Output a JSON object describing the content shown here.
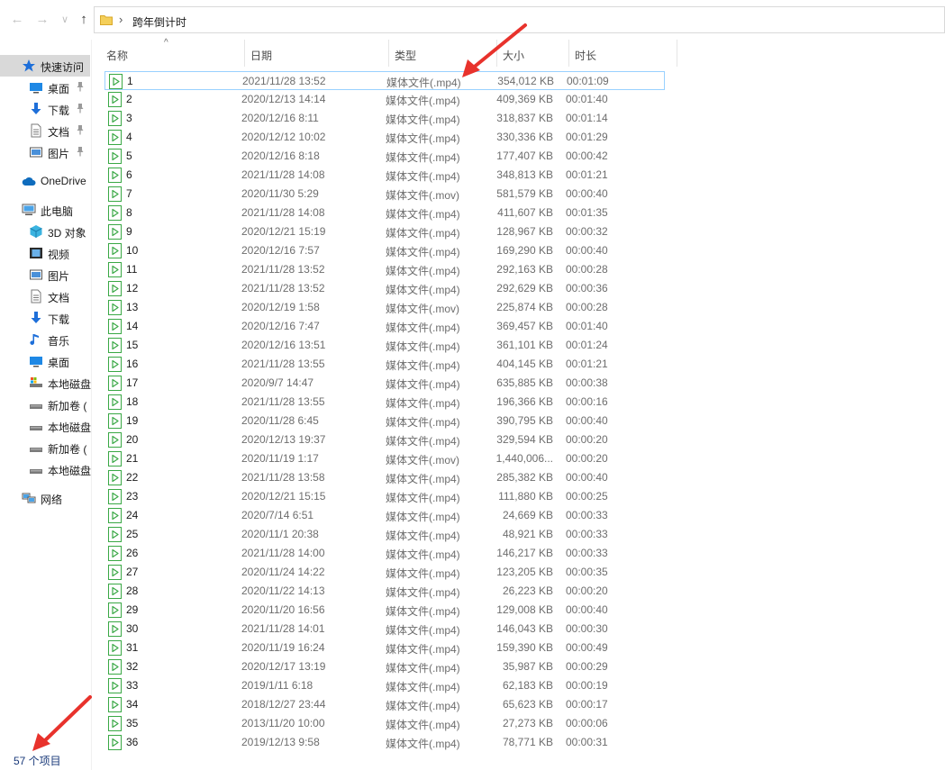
{
  "address": {
    "path": "跨年倒计时"
  },
  "nav_buttons": {
    "back": "←",
    "forward": "→",
    "recent": "∨",
    "up": "↑"
  },
  "sidebar": {
    "items": [
      {
        "label": "快速访问",
        "icon": "star-icon",
        "level": 0,
        "pinned": false,
        "selected": true
      },
      {
        "label": "桌面",
        "icon": "desktop-icon",
        "level": 1,
        "pinned": true
      },
      {
        "label": "下载",
        "icon": "download-icon",
        "level": 1,
        "pinned": true
      },
      {
        "label": "文档",
        "icon": "document-icon",
        "level": 1,
        "pinned": true
      },
      {
        "label": "图片",
        "icon": "pictures-icon",
        "level": 1,
        "pinned": true
      },
      {
        "label": "OneDrive",
        "icon": "cloud-icon",
        "level": 0,
        "gap": true
      },
      {
        "label": "此电脑",
        "icon": "computer-icon",
        "level": 0,
        "gap": true
      },
      {
        "label": "3D 对象",
        "icon": "cube-icon",
        "level": 1
      },
      {
        "label": "视频",
        "icon": "video-icon",
        "level": 1
      },
      {
        "label": "图片",
        "icon": "pictures-icon",
        "level": 1
      },
      {
        "label": "文档",
        "icon": "document-icon",
        "level": 1
      },
      {
        "label": "下载",
        "icon": "download-icon",
        "level": 1
      },
      {
        "label": "音乐",
        "icon": "music-icon",
        "level": 1
      },
      {
        "label": "桌面",
        "icon": "desktop-icon",
        "level": 1
      },
      {
        "label": "本地磁盘",
        "icon": "system-drive-icon",
        "level": 1
      },
      {
        "label": "新加卷 (",
        "icon": "drive-icon",
        "level": 1
      },
      {
        "label": "本地磁盘",
        "icon": "drive-icon",
        "level": 1
      },
      {
        "label": "新加卷 (",
        "icon": "drive-icon",
        "level": 1
      },
      {
        "label": "本地磁盘",
        "icon": "drive-icon",
        "level": 1
      },
      {
        "label": "网络",
        "icon": "network-icon",
        "level": 0,
        "gap": true
      }
    ]
  },
  "status": {
    "item_count": "57 个项目"
  },
  "columns": [
    {
      "label": "名称",
      "width": 160
    },
    {
      "label": "日期",
      "width": 160
    },
    {
      "label": "类型",
      "width": 120
    },
    {
      "label": "大小",
      "width": 80
    },
    {
      "label": "时长",
      "width": 120
    }
  ],
  "sort_indicator": "^",
  "files": [
    {
      "name": "1",
      "date": "2021/11/28 13:52",
      "type": "媒体文件(.mp4)",
      "size": "354,012 KB",
      "duration": "00:01:09"
    },
    {
      "name": "2",
      "date": "2020/12/13 14:14",
      "type": "媒体文件(.mp4)",
      "size": "409,369 KB",
      "duration": "00:01:40"
    },
    {
      "name": "3",
      "date": "2020/12/16 8:11",
      "type": "媒体文件(.mp4)",
      "size": "318,837 KB",
      "duration": "00:01:14"
    },
    {
      "name": "4",
      "date": "2020/12/12 10:02",
      "type": "媒体文件(.mp4)",
      "size": "330,336 KB",
      "duration": "00:01:29"
    },
    {
      "name": "5",
      "date": "2020/12/16 8:18",
      "type": "媒体文件(.mp4)",
      "size": "177,407 KB",
      "duration": "00:00:42"
    },
    {
      "name": "6",
      "date": "2021/11/28 14:08",
      "type": "媒体文件(.mp4)",
      "size": "348,813 KB",
      "duration": "00:01:21"
    },
    {
      "name": "7",
      "date": "2020/11/30 5:29",
      "type": "媒体文件(.mov)",
      "size": "581,579 KB",
      "duration": "00:00:40"
    },
    {
      "name": "8",
      "date": "2021/11/28 14:08",
      "type": "媒体文件(.mp4)",
      "size": "411,607 KB",
      "duration": "00:01:35"
    },
    {
      "name": "9",
      "date": "2020/12/21 15:19",
      "type": "媒体文件(.mp4)",
      "size": "128,967 KB",
      "duration": "00:00:32"
    },
    {
      "name": "10",
      "date": "2020/12/16 7:57",
      "type": "媒体文件(.mp4)",
      "size": "169,290 KB",
      "duration": "00:00:40"
    },
    {
      "name": "11",
      "date": "2021/11/28 13:52",
      "type": "媒体文件(.mp4)",
      "size": "292,163 KB",
      "duration": "00:00:28"
    },
    {
      "name": "12",
      "date": "2021/11/28 13:52",
      "type": "媒体文件(.mp4)",
      "size": "292,629 KB",
      "duration": "00:00:36"
    },
    {
      "name": "13",
      "date": "2020/12/19 1:58",
      "type": "媒体文件(.mov)",
      "size": "225,874 KB",
      "duration": "00:00:28"
    },
    {
      "name": "14",
      "date": "2020/12/16 7:47",
      "type": "媒体文件(.mp4)",
      "size": "369,457 KB",
      "duration": "00:01:40"
    },
    {
      "name": "15",
      "date": "2020/12/16 13:51",
      "type": "媒体文件(.mp4)",
      "size": "361,101 KB",
      "duration": "00:01:24"
    },
    {
      "name": "16",
      "date": "2021/11/28 13:55",
      "type": "媒体文件(.mp4)",
      "size": "404,145 KB",
      "duration": "00:01:21"
    },
    {
      "name": "17",
      "date": "2020/9/7 14:47",
      "type": "媒体文件(.mp4)",
      "size": "635,885 KB",
      "duration": "00:00:38"
    },
    {
      "name": "18",
      "date": "2021/11/28 13:55",
      "type": "媒体文件(.mp4)",
      "size": "196,366 KB",
      "duration": "00:00:16"
    },
    {
      "name": "19",
      "date": "2020/11/28 6:45",
      "type": "媒体文件(.mp4)",
      "size": "390,795 KB",
      "duration": "00:00:40"
    },
    {
      "name": "20",
      "date": "2020/12/13 19:37",
      "type": "媒体文件(.mp4)",
      "size": "329,594 KB",
      "duration": "00:00:20"
    },
    {
      "name": "21",
      "date": "2020/11/19 1:17",
      "type": "媒体文件(.mov)",
      "size": "1,440,006...",
      "duration": "00:00:20"
    },
    {
      "name": "22",
      "date": "2021/11/28 13:58",
      "type": "媒体文件(.mp4)",
      "size": "285,382 KB",
      "duration": "00:00:40"
    },
    {
      "name": "23",
      "date": "2020/12/21 15:15",
      "type": "媒体文件(.mp4)",
      "size": "111,880 KB",
      "duration": "00:00:25"
    },
    {
      "name": "24",
      "date": "2020/7/14 6:51",
      "type": "媒体文件(.mp4)",
      "size": "24,669 KB",
      "duration": "00:00:33"
    },
    {
      "name": "25",
      "date": "2020/11/1 20:38",
      "type": "媒体文件(.mp4)",
      "size": "48,921 KB",
      "duration": "00:00:33"
    },
    {
      "name": "26",
      "date": "2021/11/28 14:00",
      "type": "媒体文件(.mp4)",
      "size": "146,217 KB",
      "duration": "00:00:33"
    },
    {
      "name": "27",
      "date": "2020/11/24 14:22",
      "type": "媒体文件(.mp4)",
      "size": "123,205 KB",
      "duration": "00:00:35"
    },
    {
      "name": "28",
      "date": "2020/11/22 14:13",
      "type": "媒体文件(.mp4)",
      "size": "26,223 KB",
      "duration": "00:00:20"
    },
    {
      "name": "29",
      "date": "2020/11/20 16:56",
      "type": "媒体文件(.mp4)",
      "size": "129,008 KB",
      "duration": "00:00:40"
    },
    {
      "name": "30",
      "date": "2021/11/28 14:01",
      "type": "媒体文件(.mp4)",
      "size": "146,043 KB",
      "duration": "00:00:30"
    },
    {
      "name": "31",
      "date": "2020/11/19 16:24",
      "type": "媒体文件(.mp4)",
      "size": "159,390 KB",
      "duration": "00:00:49"
    },
    {
      "name": "32",
      "date": "2020/12/17 13:19",
      "type": "媒体文件(.mp4)",
      "size": "35,987 KB",
      "duration": "00:00:29"
    },
    {
      "name": "33",
      "date": "2019/1/11 6:18",
      "type": "媒体文件(.mp4)",
      "size": "62,183 KB",
      "duration": "00:00:19"
    },
    {
      "name": "34",
      "date": "2018/12/27 23:44",
      "type": "媒体文件(.mp4)",
      "size": "65,623 KB",
      "duration": "00:00:17"
    },
    {
      "name": "35",
      "date": "2013/11/20 10:00",
      "type": "媒体文件(.mp4)",
      "size": "27,273 KB",
      "duration": "00:00:06"
    },
    {
      "name": "36",
      "date": "2019/12/13 9:58",
      "type": "媒体文件(.mp4)",
      "size": "78,771 KB",
      "duration": "00:00:31"
    }
  ],
  "colors": {
    "accent_arrow": "#e8322c",
    "focus_border": "#99d1ff",
    "file_icon_green": "#3aa845",
    "folder_yellow": "#f4cf5a",
    "selected_bg": "#d9d9d9"
  }
}
